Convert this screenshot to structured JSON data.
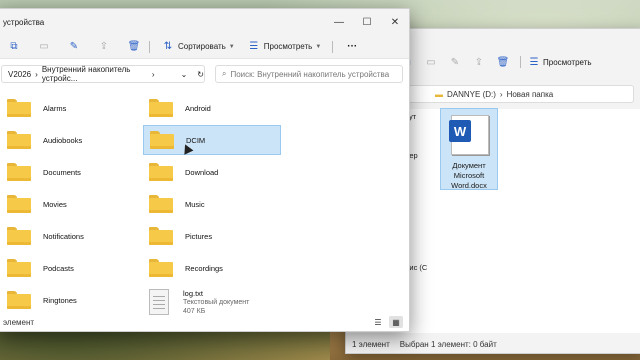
{
  "back_window": {
    "toolbar": {
      "more_label": "Просмотреть"
    },
    "address": {
      "drive": "DANNYE (D:)",
      "folder": "Новая папка"
    },
    "side_labels": [
      "пут",
      "лер",
      "дис (С"
    ],
    "file": {
      "name_line1": "Документ",
      "name_line2": "Microsoft",
      "name_line3": "Word.docx"
    },
    "status": {
      "count": "1 элемент",
      "selected": "Выбран 1 элемент: 0 байт"
    }
  },
  "front_window": {
    "title": "устройства",
    "toolbar": {
      "sort_label": "Сортировать",
      "view_label": "Просмотреть",
      "more": "···"
    },
    "address": {
      "device": "V2026",
      "path": "Внутренний накопитель устройс..."
    },
    "search": {
      "placeholder": "Поиск: Внутренний накопитель устройства"
    },
    "items": [
      {
        "name": "Alarms"
      },
      {
        "name": "Android"
      },
      {
        "name": "Audiobooks"
      },
      {
        "name": "DCIM"
      },
      {
        "name": "Documents"
      },
      {
        "name": "Download"
      },
      {
        "name": "Movies"
      },
      {
        "name": "Music"
      },
      {
        "name": "Notifications"
      },
      {
        "name": "Pictures"
      },
      {
        "name": "Podcasts"
      },
      {
        "name": "Recordings"
      },
      {
        "name": "Ringtones"
      }
    ],
    "file": {
      "name": "log.txt",
      "type": "Текстовый документ",
      "size": "407 КБ"
    },
    "status": {
      "count": "элемент"
    }
  },
  "icons": [
    "copy-icon",
    "paste-icon",
    "rename-icon",
    "share-icon",
    "delete-icon",
    "sort-icon",
    "view-icon",
    "more-icon",
    "search-icon",
    "refresh-icon",
    "folder-icon",
    "text-file-icon",
    "word-icon"
  ],
  "colors": {
    "folder": "#f7c948",
    "selection": "#cce4f7",
    "accent": "#2d62c7",
    "word": "#1f5bb4"
  }
}
